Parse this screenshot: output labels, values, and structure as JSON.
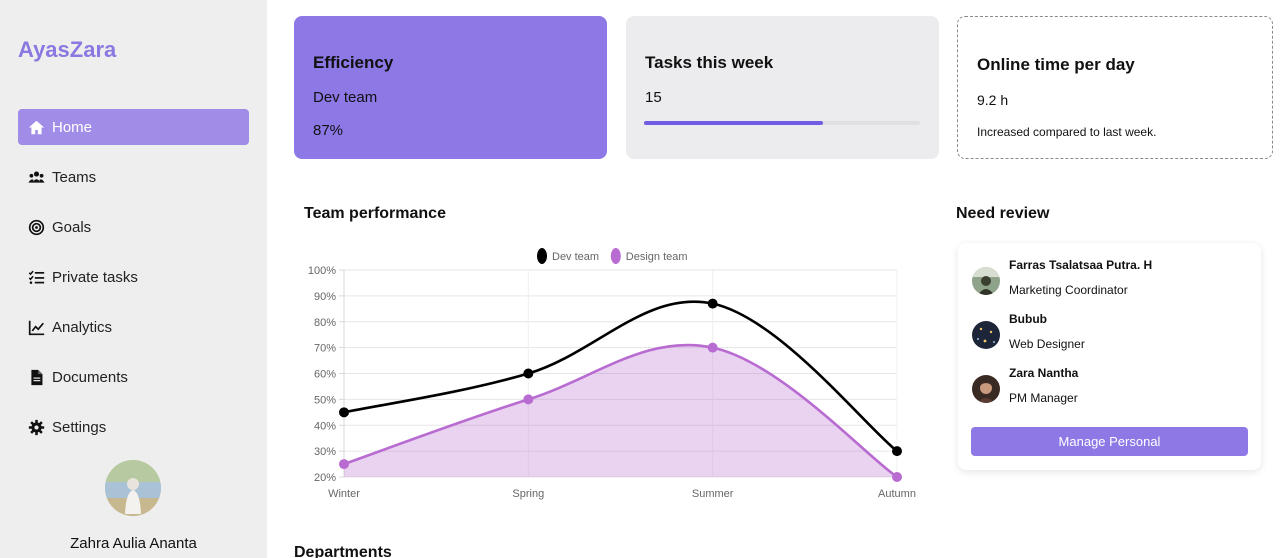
{
  "brand": "AyasZara",
  "sidebar": {
    "items": [
      {
        "label": "Home",
        "icon": "home-icon"
      },
      {
        "label": "Teams",
        "icon": "users-icon"
      },
      {
        "label": "Goals",
        "icon": "target-icon"
      },
      {
        "label": "Private tasks",
        "icon": "checklist-icon"
      },
      {
        "label": "Analytics",
        "icon": "line-chart-icon"
      },
      {
        "label": "Documents",
        "icon": "document-icon"
      },
      {
        "label": "Settings",
        "icon": "gear-icon"
      }
    ],
    "active_item": "Home",
    "profile_name": "Zahra Aulia Ananta"
  },
  "cards": {
    "efficiency": {
      "title": "Efficiency",
      "subtitle": "Dev team",
      "value": "87%"
    },
    "tasks": {
      "title": "Tasks this week",
      "value": "15",
      "progress_percent": 65
    },
    "online": {
      "title": "Online time per day",
      "value": "9.2 h",
      "note": "Increased compared to last week."
    }
  },
  "performance": {
    "title": "Team performance"
  },
  "review": {
    "title": "Need review",
    "people": [
      {
        "name": "Farras Tsalatsaa Putra. H",
        "role": "Marketing Coordinator"
      },
      {
        "name": "Bubub",
        "role": "Web Designer"
      },
      {
        "name": "Zara Nantha",
        "role": "PM Manager"
      }
    ],
    "button_label": "Manage Personal"
  },
  "departments": {
    "title": "Departments"
  },
  "colors": {
    "accent": "#8d78e6",
    "dev_series": "#000000",
    "design_series": "#b86bd0",
    "sidebar_bg": "#efeeee"
  },
  "chart_data": {
    "type": "line",
    "categories": [
      "Winter",
      "Spring",
      "Summer",
      "Autumn"
    ],
    "series": [
      {
        "name": "Dev team",
        "values": [
          45,
          60,
          87,
          30
        ],
        "color": "#000000",
        "fill": false
      },
      {
        "name": "Design team",
        "values": [
          25,
          50,
          70,
          20
        ],
        "color": "#b86bd0",
        "fill": true
      }
    ],
    "y_ticks": [
      "20%",
      "30%",
      "40%",
      "50%",
      "60%",
      "70%",
      "80%",
      "90%",
      "100%"
    ],
    "ylim": [
      20,
      100
    ],
    "y_unit": "%",
    "legend_position": "top",
    "grid": true,
    "curve": "smooth"
  }
}
